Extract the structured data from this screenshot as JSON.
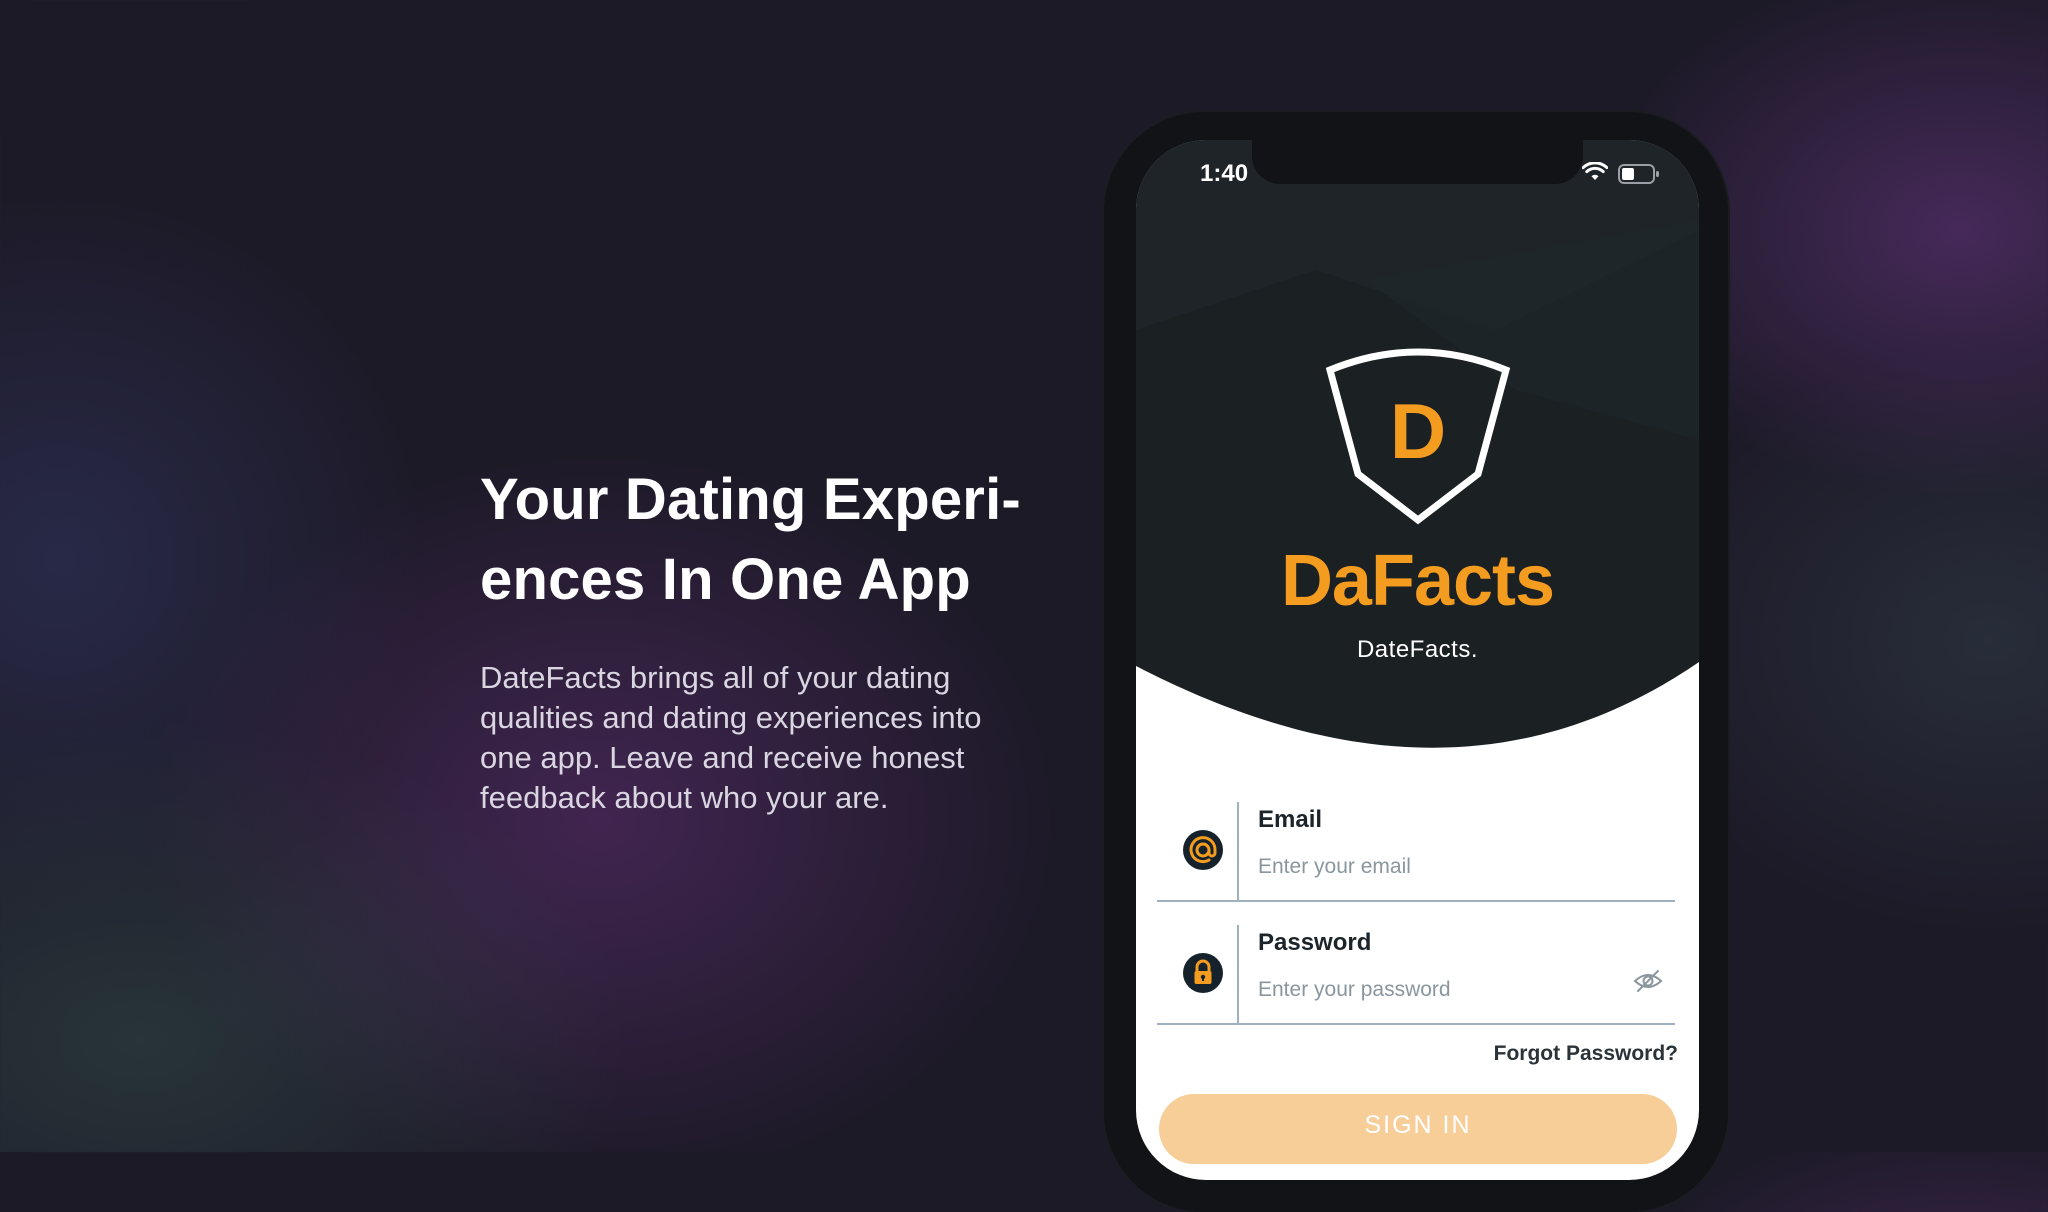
{
  "promo": {
    "headline_line1": "Your Dating Experi-",
    "headline_line2": "ences In One App",
    "description": "DateFacts brings all of your dating qualities and dating experiences into one app. Leave and receive honest feedback about who your are."
  },
  "status_bar": {
    "time": "1:40",
    "icons": [
      "wifi-icon",
      "battery-icon"
    ]
  },
  "brand": {
    "logo_letter": "D",
    "name": "DaFacts",
    "tagline": "DateFacts.",
    "accent_color": "#f39c1f",
    "dark_color": "#1b2023"
  },
  "form": {
    "email": {
      "label": "Email",
      "placeholder": "Enter your email",
      "icon": "at-icon"
    },
    "password": {
      "label": "Password",
      "placeholder": "Enter your password",
      "icon": "lock-icon",
      "toggle_icon": "eye-off-icon"
    },
    "forgot_password": "Forgot Password?",
    "sign_in": "SIGN IN"
  }
}
